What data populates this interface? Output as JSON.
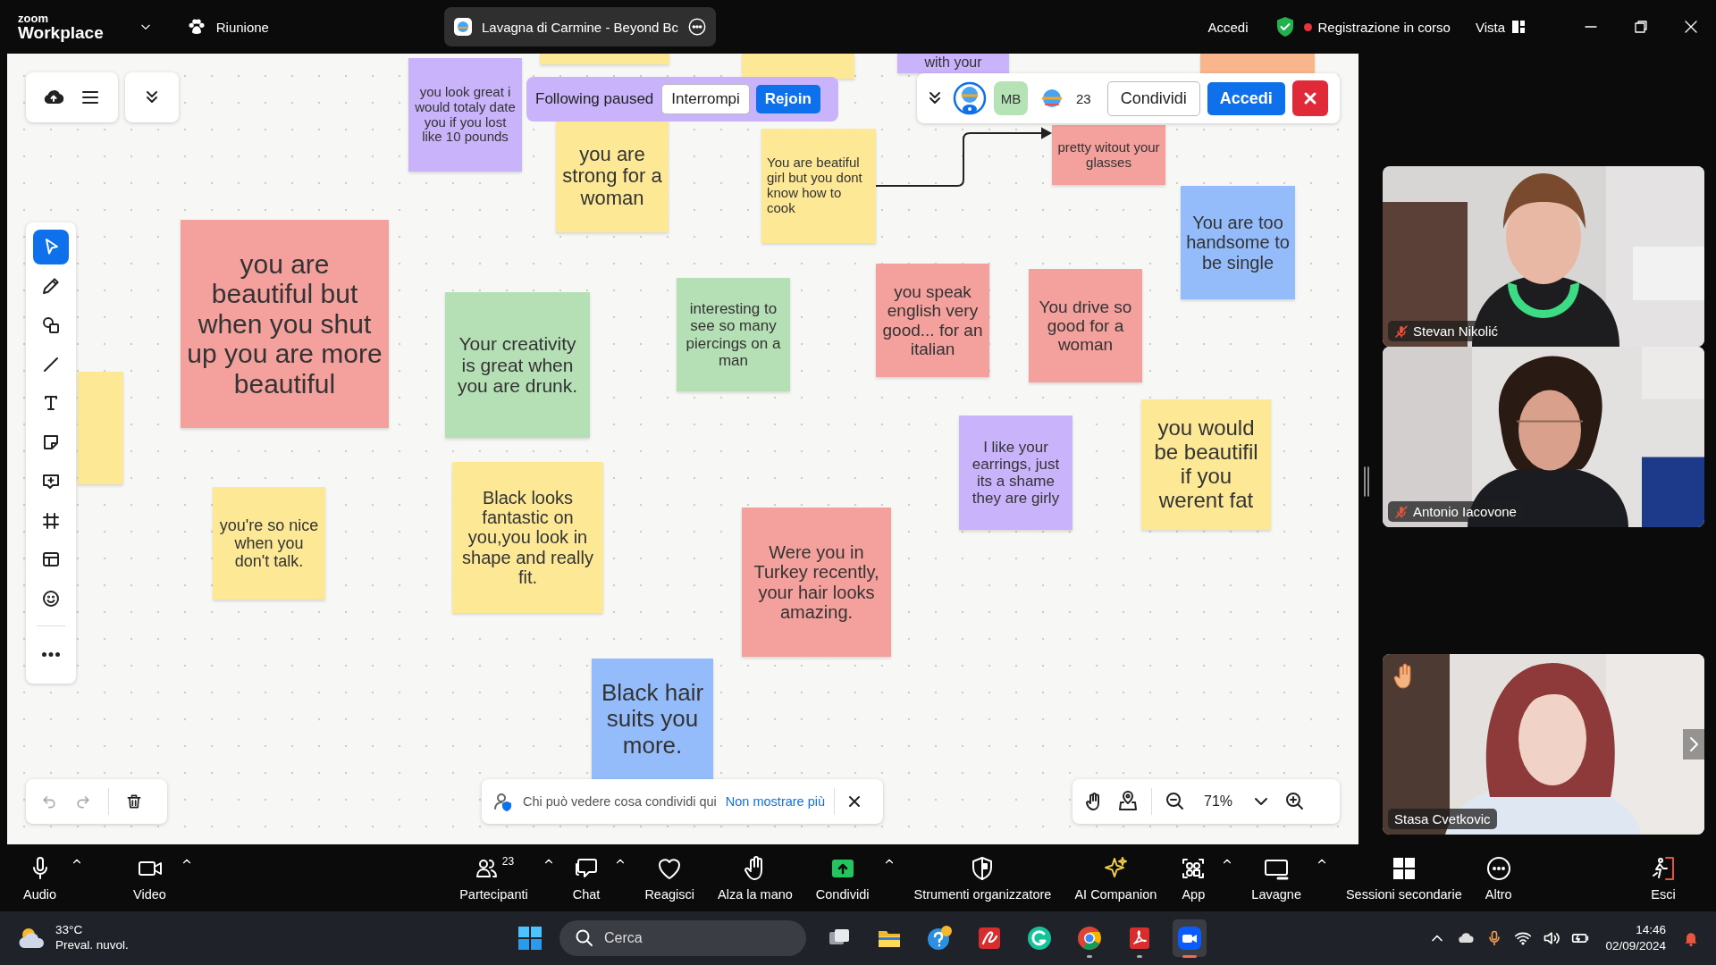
{
  "app_bar": {
    "logo_top": "zoom",
    "logo_bottom": "Workplace",
    "meeting_menu": "Riunione",
    "tab_title": "Lavagna di Carmine - Beyond Bc",
    "sign_in": "Accedi",
    "recording": "Registrazione in corso",
    "view": "Vista"
  },
  "board": {
    "notes": [
      {
        "color": "#fde995"
      },
      {
        "text": "you look great i would totaly date you if you lost like 10 pounds",
        "color": "#c9b3fb"
      },
      {
        "color": "#fde995"
      },
      {
        "text": "with your",
        "color": "#c9b3fb"
      },
      {
        "color": "#f9b58c"
      },
      {
        "text": "you are strong for a woman",
        "color": "#fde995"
      },
      {
        "text": "You are beatiful girl but you dont know how to cook",
        "color": "#fde995"
      },
      {
        "text": "pretty witout your glasses",
        "color": "#f4a09c"
      },
      {
        "text": "You are too handsome to be single",
        "color": "#94bcfb"
      },
      {
        "text": "you are beautiful but when you shut up you are more beautiful",
        "color": "#f4a09c"
      },
      {
        "text": "Your creativity is great when you are drunk.",
        "color": "#b5dfb5"
      },
      {
        "text": "interesting to see so many piercings on a man",
        "color": "#b5dfb5"
      },
      {
        "text": "you speak english very good... for an italian",
        "color": "#f4a09c"
      },
      {
        "text": "You drive so good for a woman",
        "color": "#f4a09c"
      },
      {
        "color": "#fde995"
      },
      {
        "text": "I like your earrings, just its a shame they are girly",
        "color": "#c9b3fb"
      },
      {
        "text": "you would be beautifil if you werent fat",
        "color": "#fde995"
      },
      {
        "text": "you're so nice when you don't talk.",
        "color": "#fde995"
      },
      {
        "text": "Black looks fantastic on you,you look in shape and really fit.",
        "color": "#fde995"
      },
      {
        "text": "Were you in Turkey recently, your hair looks amazing.",
        "color": "#f4a09c"
      },
      {
        "text": "Black hair suits you more.",
        "color": "#94bcfb"
      }
    ],
    "follow_banner": {
      "text": "Following paused",
      "buttons": [
        {
          "label": "Interrompi",
          "kind": "secondary"
        },
        {
          "label": "Rejoin",
          "kind": "primary"
        }
      ]
    },
    "collab_bar": {
      "avatars": [
        {
          "kind": "self"
        },
        {
          "kind": "initials",
          "initials": "MB",
          "color": "#b5e3b5"
        },
        {
          "kind": "logo"
        }
      ],
      "count": "23",
      "buttons": [
        {
          "label": "Condividi",
          "kind": "secondary"
        },
        {
          "label": "Accedi",
          "kind": "primary"
        }
      ]
    },
    "tools": [
      {
        "kind": "select",
        "selected": true
      },
      {
        "kind": "pen",
        "selected": false
      },
      {
        "kind": "shapes",
        "selected": false
      },
      {
        "kind": "line",
        "selected": false
      },
      {
        "kind": "text",
        "selected": false
      },
      {
        "kind": "sticky",
        "selected": false
      },
      {
        "kind": "comment",
        "selected": false
      },
      {
        "kind": "frame",
        "selected": false
      },
      {
        "kind": "template",
        "selected": false
      },
      {
        "kind": "emoji",
        "selected": false
      },
      {
        "kind": "more",
        "selected": false
      }
    ],
    "history": [
      {
        "kind": "undo",
        "disabled": true
      },
      {
        "kind": "redo",
        "disabled": true
      },
      {
        "kind": "delete",
        "disabled": false
      }
    ],
    "privacy_hint": {
      "text": "Chi può vedere cosa condividi qui",
      "link": "Non mostrare più"
    },
    "zoom_controls": {
      "level_text": "71%"
    }
  },
  "participants": [
    {
      "name": "Stevan Nikolić",
      "muted": true,
      "hand_raised": false
    },
    {
      "name": "Antonio Iacovone",
      "muted": true,
      "hand_raised": false
    },
    {
      "name": "Stasa Cvetkovic",
      "muted": false,
      "hand_raised": true
    }
  ],
  "meeting_controls": [
    {
      "kind": "audio",
      "label": "Audio",
      "menu": true
    },
    {
      "kind": "video",
      "label": "Video",
      "menu": true
    },
    {
      "kind": "participants",
      "label": "Partecipanti",
      "count": "23",
      "menu": true
    },
    {
      "kind": "chat",
      "label": "Chat",
      "menu": true
    },
    {
      "kind": "react",
      "label": "Reagisci",
      "menu": false
    },
    {
      "kind": "hand",
      "label": "Alza la mano",
      "menu": false
    },
    {
      "kind": "share",
      "label": "Condividi",
      "menu": true
    },
    {
      "kind": "host",
      "label": "Strumenti organizzatore",
      "menu": false
    },
    {
      "kind": "ai",
      "label": "AI Companion",
      "menu": false
    },
    {
      "kind": "apps",
      "label": "App",
      "menu": true
    },
    {
      "kind": "whiteboard",
      "label": "Lavagne",
      "menu": true
    },
    {
      "kind": "rooms",
      "label": "Sessioni secondarie",
      "menu": false
    },
    {
      "kind": "more",
      "label": "Altro",
      "menu": false
    },
    {
      "kind": "leave",
      "label": "Esci",
      "menu": false
    }
  ],
  "taskbar": {
    "weather": {
      "temp": "33°C",
      "condition": "Preval. nuvol."
    },
    "search_placeholder": "Cerca",
    "apps": [
      {
        "kind": "task-view",
        "running": false
      },
      {
        "kind": "folder",
        "running": false
      },
      {
        "kind": "help",
        "running": false
      },
      {
        "kind": "signature",
        "running": false
      },
      {
        "kind": "ring",
        "running": false
      },
      {
        "kind": "browser",
        "running": true
      },
      {
        "kind": "document",
        "running": true
      },
      {
        "kind": "meeting",
        "running": true
      }
    ],
    "time": "14:46",
    "date": "02/09/2024"
  }
}
